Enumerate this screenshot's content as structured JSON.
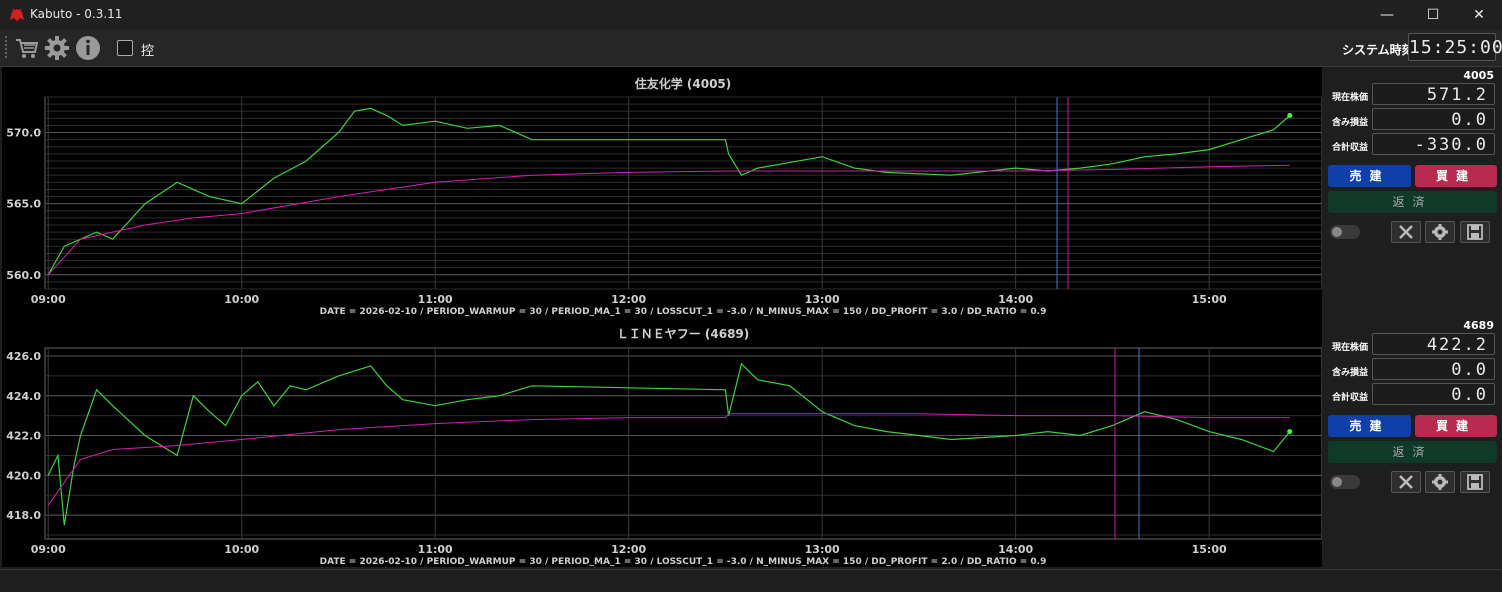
{
  "window": {
    "title": "Kabuto - 0.3.11",
    "minimize": "—",
    "maximize": "☐",
    "close": "✕"
  },
  "toolbar": {
    "checkbox_label": "控",
    "system_time_label": "システム時刻",
    "system_time": "15:25:00"
  },
  "colors": {
    "price_line": "#3fcf3f",
    "ma_line": "#d020b0",
    "marker_blue": "#3a7ac8",
    "marker_magenta": "#c020a0",
    "sell": "#0f3fa8",
    "buy": "#b82b4e",
    "repay": "#0f3a2a"
  },
  "x_ticks": [
    "09:00",
    "10:00",
    "11:00",
    "12:00",
    "13:00",
    "14:00",
    "15:00"
  ],
  "charts": [
    {
      "title": "住友化学 (4005)",
      "y_ticks": [
        "560.0",
        "565.0",
        "570.0"
      ],
      "footer": "DATE = 2026-02-10 / PERIOD_WARMUP = 30 / PERIOD_MA_1 = 30 / LOSSCUT_1 = -3.0 / N_MINUS_MAX = 150 / DD_PROFIT = 3.0 / DD_RATIO = 0.9"
    },
    {
      "title": "ＬＩＮＥヤフー (4689)",
      "y_ticks": [
        "418.0",
        "420.0",
        "422.0",
        "424.0",
        "426.0"
      ],
      "footer": "DATE = 2026-02-10 / PERIOD_WARMUP = 30 / PERIOD_MA_1 = 30 / LOSSCUT_1 = -3.0 / N_MINUS_MAX = 150 / DD_PROFIT = 2.0 / DD_RATIO = 0.9"
    }
  ],
  "chart_data": [
    {
      "type": "line",
      "title": "住友化学 (4005)",
      "xlabel": "",
      "ylabel": "",
      "ylim": [
        559.0,
        572.5
      ],
      "xlim": [
        "08:59",
        "15:35"
      ],
      "grid": true,
      "series": [
        {
          "name": "",
          "x": [
            "09:00",
            "09:05",
            "09:10",
            "09:15",
            "09:20",
            "09:30",
            "09:40",
            "09:45",
            "09:50",
            "10:00",
            "10:10",
            "10:20",
            "10:30",
            "10:35",
            "10:40",
            "10:45",
            "10:50",
            "11:00",
            "11:10",
            "11:20",
            "11:30",
            "11:50",
            "12:30",
            "12:31",
            "12:35",
            "12:40",
            "13:00",
            "13:10",
            "13:20",
            "13:40",
            "14:00",
            "14:10",
            "14:20",
            "14:30",
            "14:40",
            "14:50",
            "15:00",
            "15:10",
            "15:20",
            "15:25"
          ],
          "y": [
            560.0,
            562.0,
            562.5,
            563.0,
            562.5,
            565.0,
            566.5,
            566.0,
            565.5,
            565.0,
            566.8,
            568.0,
            570.0,
            571.5,
            571.7,
            571.2,
            570.5,
            570.8,
            570.3,
            570.5,
            569.5,
            569.5,
            569.5,
            568.5,
            567.0,
            567.5,
            568.3,
            567.5,
            567.2,
            567.0,
            567.5,
            567.3,
            567.5,
            567.8,
            568.3,
            568.5,
            568.8,
            569.5,
            570.2,
            571.2
          ]
        },
        {
          "name": "",
          "x": [
            "09:00",
            "09:10",
            "09:30",
            "09:45",
            "10:00",
            "10:30",
            "11:00",
            "11:30",
            "12:00",
            "12:30",
            "13:00",
            "13:30",
            "14:00",
            "14:30",
            "15:00",
            "15:25"
          ],
          "y": [
            560.0,
            562.5,
            563.5,
            564.0,
            564.3,
            565.5,
            566.5,
            567.0,
            567.2,
            567.3,
            567.3,
            567.3,
            567.3,
            567.4,
            567.6,
            567.7
          ]
        }
      ]
    },
    {
      "type": "line",
      "title": "ＬＩＮＥヤフー (4689)",
      "xlabel": "",
      "ylabel": "",
      "ylim": [
        416.8,
        426.4
      ],
      "xlim": [
        "08:59",
        "15:35"
      ],
      "grid": true,
      "series": [
        {
          "name": "",
          "x": [
            "09:00",
            "09:03",
            "09:05",
            "09:08",
            "09:10",
            "09:15",
            "09:20",
            "09:30",
            "09:35",
            "09:40",
            "09:45",
            "09:50",
            "09:55",
            "10:00",
            "10:05",
            "10:10",
            "10:15",
            "10:20",
            "10:30",
            "10:40",
            "10:45",
            "10:50",
            "11:00",
            "11:10",
            "11:20",
            "11:30",
            "12:30",
            "12:31",
            "12:35",
            "12:40",
            "12:50",
            "13:00",
            "13:10",
            "13:20",
            "13:30",
            "13:40",
            "14:00",
            "14:10",
            "14:20",
            "14:30",
            "14:40",
            "14:50",
            "15:00",
            "15:10",
            "15:20",
            "15:25"
          ],
          "y": [
            420.0,
            421.0,
            417.5,
            420.5,
            422.0,
            424.3,
            423.5,
            422.0,
            421.5,
            421.0,
            424.0,
            423.2,
            422.5,
            424.0,
            424.7,
            423.5,
            424.5,
            424.3,
            425.0,
            425.5,
            424.5,
            423.8,
            423.5,
            423.8,
            424.0,
            424.5,
            424.3,
            423.0,
            425.6,
            424.8,
            424.5,
            423.2,
            422.5,
            422.2,
            422.0,
            421.8,
            422.0,
            422.2,
            422.0,
            422.5,
            423.2,
            422.8,
            422.2,
            421.8,
            421.2,
            422.2
          ]
        },
        {
          "name": "",
          "x": [
            "09:00",
            "09:10",
            "09:20",
            "09:40",
            "10:00",
            "10:30",
            "11:00",
            "11:30",
            "12:00",
            "12:30",
            "12:31",
            "13:00",
            "13:30",
            "14:00",
            "14:30",
            "15:00",
            "15:25"
          ],
          "y": [
            418.5,
            420.8,
            421.3,
            421.5,
            421.8,
            422.3,
            422.6,
            422.8,
            422.9,
            422.9,
            423.1,
            423.1,
            423.1,
            423.0,
            423.0,
            422.9,
            422.9
          ]
        }
      ]
    }
  ],
  "panels": [
    {
      "code": "4005",
      "rows": [
        {
          "label": "現在株価",
          "value": "571.2"
        },
        {
          "label": "含み損益",
          "value": "0.0"
        },
        {
          "label": "合計収益",
          "value": "-330.0"
        }
      ],
      "sell_label": "売建",
      "buy_label": "買建",
      "repay_label": "返済"
    },
    {
      "code": "4689",
      "rows": [
        {
          "label": "現在株価",
          "value": "422.2"
        },
        {
          "label": "含み損益",
          "value": "0.0"
        },
        {
          "label": "合計収益",
          "value": "0.0"
        }
      ],
      "sell_label": "売建",
      "buy_label": "買建",
      "repay_label": "返済"
    }
  ]
}
